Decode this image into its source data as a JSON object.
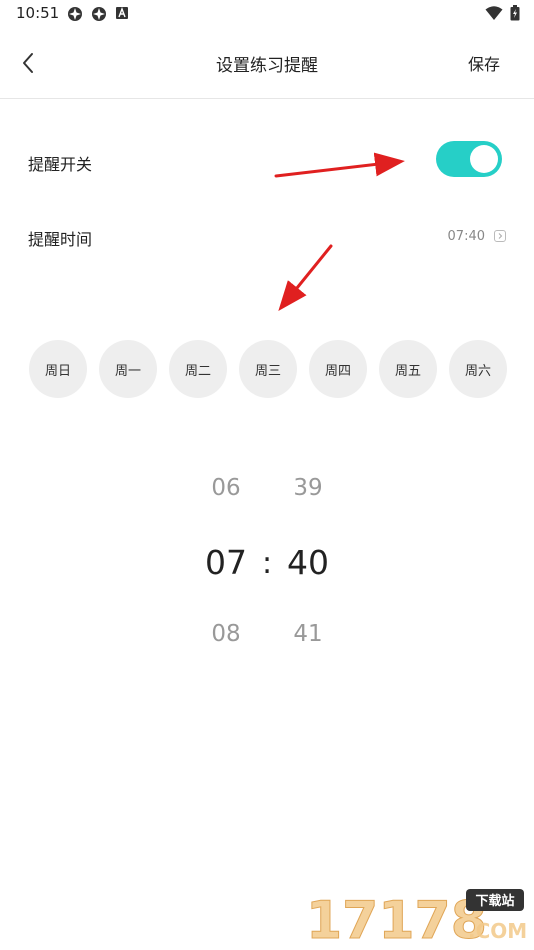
{
  "status_bar": {
    "time": "10:51"
  },
  "header": {
    "title": "设置练习提醒",
    "save_label": "保存"
  },
  "reminder_switch": {
    "label": "提醒开关",
    "on": true
  },
  "reminder_time": {
    "label": "提醒时间",
    "value": "07:40"
  },
  "weekdays": [
    "周日",
    "周一",
    "周二",
    "周三",
    "周四",
    "周五",
    "周六"
  ],
  "time_picker": {
    "hours": {
      "prev": "06",
      "selected": "07",
      "next": "08"
    },
    "minutes": {
      "prev": "39",
      "selected": "40",
      "next": "41"
    },
    "separator": ":"
  },
  "watermark": {
    "number": "17178",
    "badge": "下载站",
    "suffix": ".COM"
  },
  "colors": {
    "accent": "#26cfc7",
    "annotation_arrow": "#e02020"
  }
}
